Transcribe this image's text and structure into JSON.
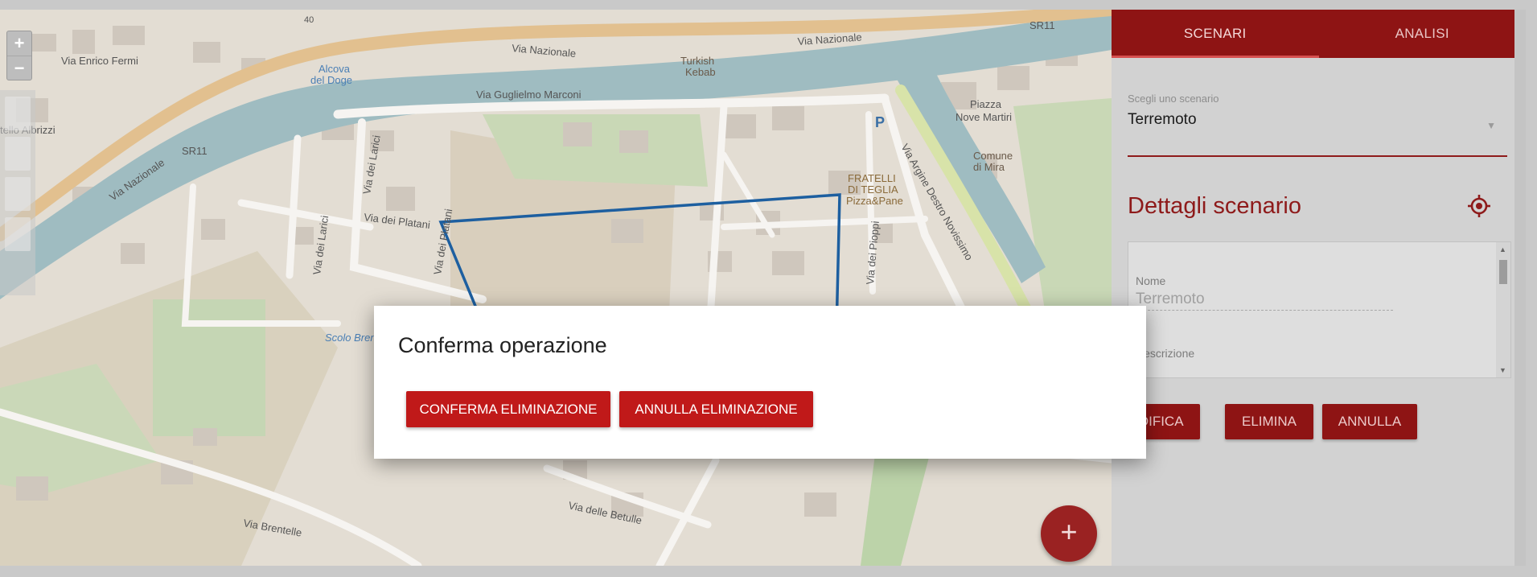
{
  "map": {
    "zoom_in": "+",
    "zoom_out": "−",
    "fab_label": "+",
    "labels": {
      "via_nazionale_1": "Via Nazionale",
      "via_nazionale_2": "Via Nazionale",
      "via_nazionale_3": "Via Nazionale",
      "via_enrico_fermi": "Via Enrico Fermi",
      "via_guglielmo_marconi": "Via Guglielmo Marconi",
      "via_dei_platani_1": "Via dei Platani",
      "via_dei_platani_2": "Via dei Platani",
      "via_dei_larici_1": "Via dei Larici",
      "via_dei_larici_2": "Via dei Larici",
      "via_dei_pioppi": "Via dei Pioppi",
      "via_argine": "Via Argine Destro Novissimo",
      "via_brentelle": "Via Brentelle",
      "via_delle_betulle": "Via delle Betulle",
      "sr11_1": "SR11",
      "sr11_2": "SR11",
      "alcova_1": "Alcova",
      "alcova_2": "del Doge",
      "turkish_1": "Turkish",
      "turkish_2": "Kebab",
      "piazza_1": "Piazza",
      "piazza_2": "Nove Martiri",
      "comune_1": "Comune",
      "comune_2": "di Mira",
      "fratelli_1": "FRATELLI",
      "fratelli_2": "DI TEGLIA",
      "fratelli_3": "Pizza&Pane",
      "scolo": "Scolo Brenta",
      "albrizzi": "tello Albrizzi",
      "num_40": "40",
      "parking": "P"
    }
  },
  "sidebar": {
    "tabs": [
      {
        "label": "SCENARI",
        "active": true
      },
      {
        "label": "ANALISI",
        "active": false
      }
    ],
    "select_label": "Scegli uno scenario",
    "select_value": "Terremoto",
    "details_title": "Dettagli scenario",
    "form": {
      "name_label": "Nome",
      "name_value": "Terremoto",
      "description_label": "Descrizione"
    },
    "buttons": {
      "modifica": "MODIFICA",
      "elimina": "ELIMINA",
      "annulla": "ANNULLA"
    }
  },
  "dialog": {
    "title": "Conferma operazione",
    "confirm_label": "CONFERMA ELIMINAZIONE",
    "cancel_label": "ANNULLA ELIMINAZIONE"
  },
  "colors": {
    "brand_red": "#c01919",
    "dark_red": "#8e1414",
    "polygon_blue": "#1d5fa0"
  }
}
